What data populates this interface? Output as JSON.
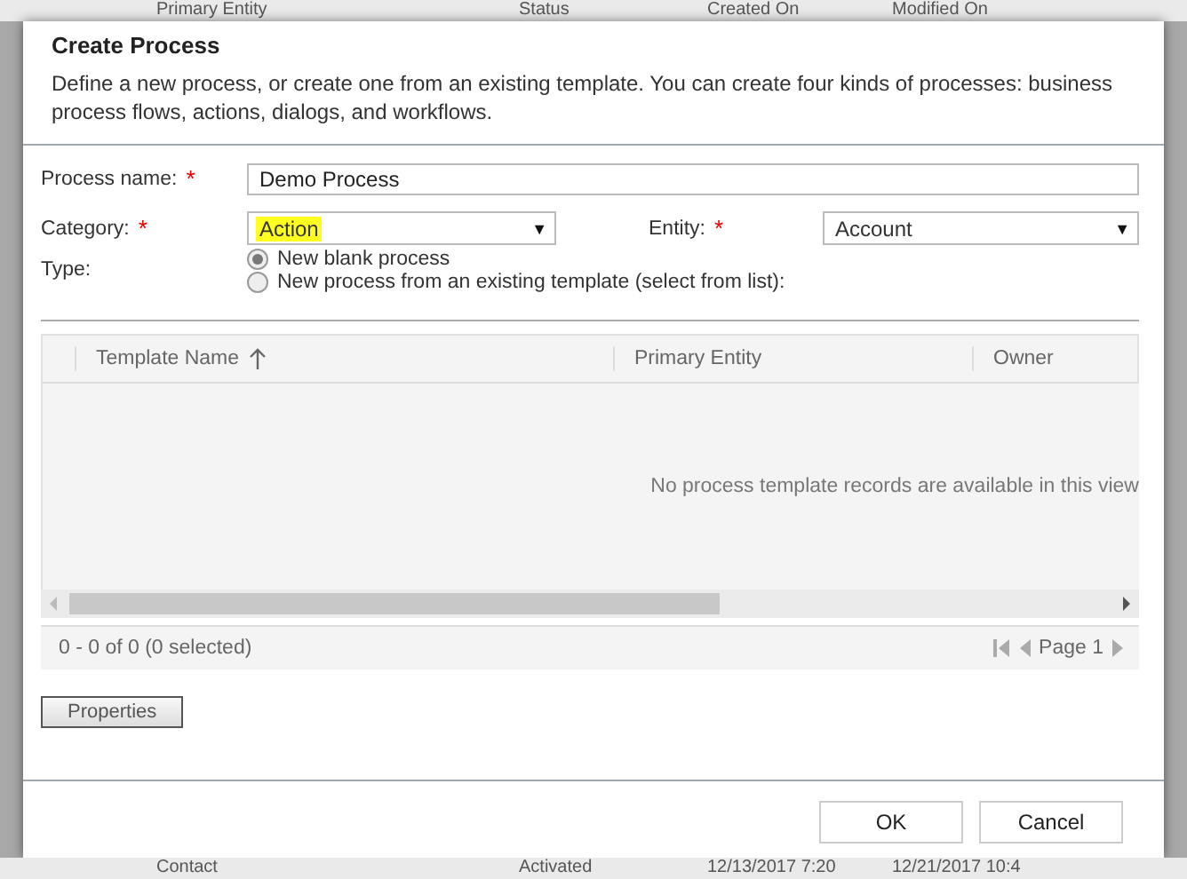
{
  "background": {
    "header": [
      "Primary Entity",
      "Status",
      "Created On",
      "Modified On"
    ],
    "row": [
      "Contact",
      "Activated",
      "12/13/2017 7:20",
      "12/21/2017 10:4"
    ]
  },
  "dialog": {
    "title": "Create Process",
    "description": "Define a new process, or create one from an existing template. You can create four kinds of processes: business process flows, actions, dialogs, and workflows.",
    "process_name": {
      "label": "Process name:",
      "required": "*",
      "value": "Demo Process"
    },
    "category": {
      "label": "Category:",
      "required": "*",
      "value": "Action",
      "highlighted": true,
      "caret": "▼"
    },
    "entity": {
      "label": "Entity:",
      "required": "*",
      "value": "Account",
      "caret": "▼"
    },
    "type": {
      "label": "Type:",
      "options": [
        {
          "label": "New blank process",
          "selected": true
        },
        {
          "label": "New process from an existing template (select from list):",
          "selected": false
        }
      ]
    },
    "grid": {
      "columns": [
        {
          "label": "Template Name",
          "sorted": true
        },
        {
          "label": "Primary Entity",
          "sorted": false
        },
        {
          "label": "Owner",
          "sorted": false
        }
      ],
      "empty_message": "No process template records are available in this view",
      "record_count": "0 - 0 of 0 (0 selected)",
      "page": "Page 1"
    },
    "properties_button": "Properties",
    "buttons": [
      "OK",
      "Cancel"
    ]
  }
}
